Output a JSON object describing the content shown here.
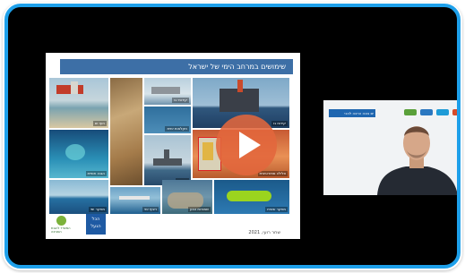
{
  "player": {
    "accent_color": "#1ea0ea",
    "play_icon": "play-icon"
  },
  "slide": {
    "title": "שימושים במרחב הימי של ישראל",
    "photos": [
      {
        "label": "חוף ים"
      },
      {
        "label": ""
      },
      {
        "label": "קידוח גז"
      },
      {
        "label": "קידוחי גז"
      },
      {
        "label": "חקלאות ימית"
      },
      {
        "label": "הגנה חופית"
      },
      {
        "label": "ביטחון"
      },
      {
        "label": "צלילה ספורטיבית"
      },
      {
        "label": "מחקר ימי"
      },
      {
        "label": "רציף ימי"
      },
      {
        "label": "שמורות טבע"
      },
      {
        "label": "מחקר שונית"
      }
    ],
    "logo_left_text": "המשרד להגנת הסביבה",
    "logo_mid_lines": [
      "הכל",
      "הגעל"
    ],
    "footer": "שחר רועי, 2021"
  },
  "webcam": {
    "banner": "ים בונה הרבה להכי"
  }
}
